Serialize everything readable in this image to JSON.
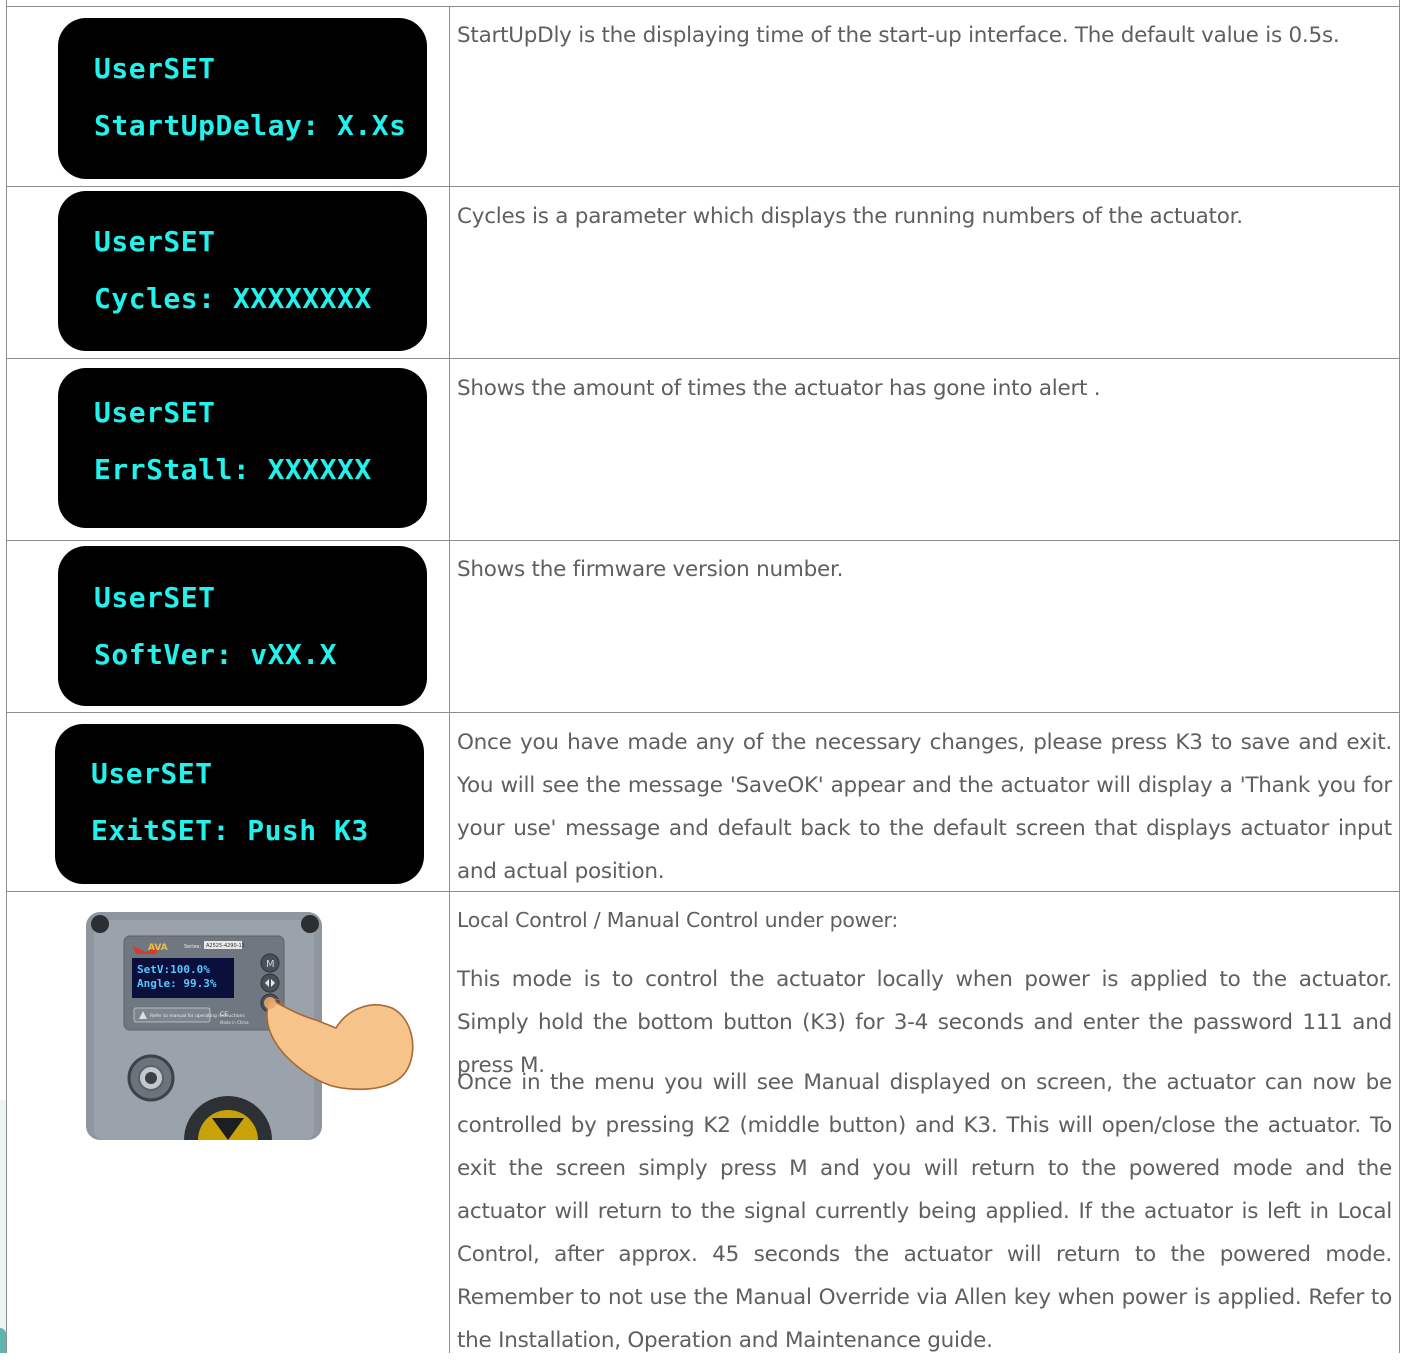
{
  "rows": [
    {
      "screen": {
        "line1": "UserSET",
        "line2": "StartUpDelay: X.Xs"
      },
      "description": "StartUpDly is the displaying time of the start-up interface. The default value is 0.5s."
    },
    {
      "screen": {
        "line1": "UserSET",
        "line2": "Cycles: XXXXXXXX"
      },
      "description": "Cycles is  a parameter which displays the running numbers of the actuator."
    },
    {
      "screen": {
        "line1": "UserSET",
        "line2": "ErrStall: XXXXXX"
      },
      "description": "Shows the amount of times the actuator has gone into alert ."
    },
    {
      "screen": {
        "line1": "UserSET",
        "line2": "SoftVer: vXX.X"
      },
      "description": "Shows the firmware version number."
    },
    {
      "screen": {
        "line1": "UserSET",
        "line2": "ExitSET: Push K3"
      },
      "description": "Once you have made any of the necessary changes, please press K3 to save and exit. You will see the message 'SaveOK' appear and the actuator will display a 'Thank you for your use' message and default back to the default screen that  displays actuator input and actual position."
    }
  ],
  "local_control": {
    "heading": "Local Control / Manual Control under power:",
    "paragraph1": "This mode is to control the actuator locally when power is applied to the actuator. Simply hold the bottom button (K3) for 3-4 seconds and enter the password 111 and press M.",
    "paragraph2": "Once in the menu you will see Manual displayed on screen, the actuator can now be controlled by pressing K2 (middle button) and K3. This will open/close the actuator. To exit the screen simply press M and you will return to the powered mode and the actuator will return to the signal currently being applied. If the actuator is left in Local Control, after approx. 45 seconds the actuator will return to the powered mode. Remember to not use the Manual Override via Allen key when power is applied. Refer to the Installation, Operation and Maintenance guide.",
    "device": {
      "brand": "AVA",
      "series_label": "Series:",
      "series_code": "A2525-4290-11",
      "display_line1": "SetV:100.0%",
      "display_line2": "Angle: 99.3%",
      "warning": "Refer to manual for operating instructions",
      "ce_text": "CE",
      "made_in": "Made in China",
      "btn_m": "M"
    }
  },
  "colors": {
    "lcd_bg": "#000000",
    "lcd_text": "#23f2ec",
    "border": "#8f8f8f",
    "body_text": "#5f5f5f",
    "housing": "#8e96a0",
    "finger": "#f6c38a"
  }
}
